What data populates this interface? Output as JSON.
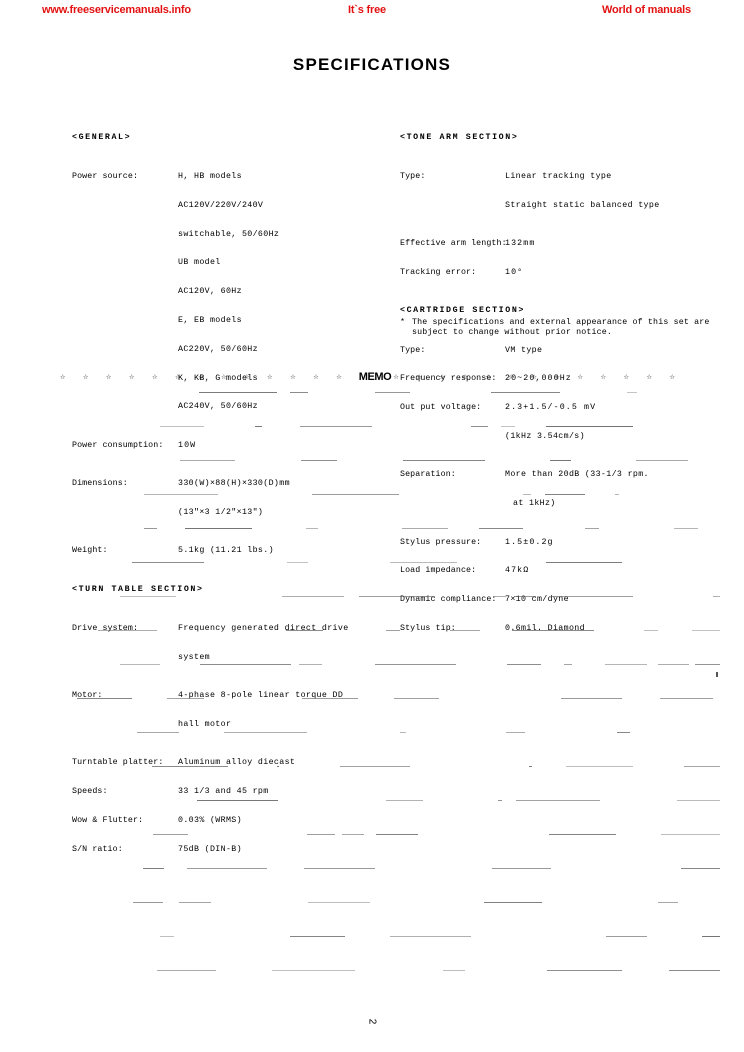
{
  "banner": {
    "left": "www.freeservicemanuals.info",
    "center": "It`s free",
    "right": "World of manuals",
    "color": "#e31111"
  },
  "title": "SPECIFICATIONS",
  "general": {
    "heading": "<GENERAL>",
    "rows": [
      {
        "label": "Power source:",
        "value": "H, HB models",
        "continued": [
          "  AC120V/220V/240V",
          "  switchable,  50/60Hz",
          "UB model",
          "  AC120V,  60Hz",
          "E, EB models",
          "  AC220V,  50/60Hz",
          "K, KB, G models",
          "  AC240V,  50/60Hz"
        ]
      },
      {
        "label": "Power consumption:",
        "value": "10W",
        "continued": []
      },
      {
        "label": "Dimensions:",
        "value": "330(W)×88(H)×330(D)mm",
        "continued": [
          "(13\"×3 1/2\"×13\")"
        ]
      },
      {
        "label": "Weight:",
        "value": "5.1kg (11.21 lbs.)",
        "continued": []
      }
    ]
  },
  "turntable": {
    "heading": "<TURN TABLE SECTION>",
    "rows": [
      {
        "label": "Drive system:",
        "value": "Frequency generated direct drive",
        "continued": [
          "system"
        ]
      },
      {
        "label": "Motor:",
        "value": "4-phase 8-pole linear torque DD",
        "continued": [
          "hall motor"
        ]
      },
      {
        "label": "Turntable platter:",
        "value": "Aluminum alloy diecast",
        "continued": []
      },
      {
        "label": "Speeds:",
        "value": "33 1/3 and 45 rpm",
        "continued": []
      },
      {
        "label": "Wow & Flutter:",
        "value": "0.03% (WRMS)",
        "continued": []
      },
      {
        "label": "S/N ratio:",
        "value": "75dB (DIN-B)",
        "continued": []
      }
    ]
  },
  "tonearm": {
    "heading": "<TONE ARM SECTION>",
    "rows": [
      {
        "label": "Type:",
        "value": "Linear tracking type",
        "continued": [
          "Straight static balanced type"
        ]
      },
      {
        "label": "Effective arm length:",
        "value": "132mm",
        "continued": []
      },
      {
        "label": "Tracking error:",
        "value": "10°",
        "continued": []
      }
    ]
  },
  "cartridge": {
    "heading": "<CARTRIDGE SECTION>",
    "rows": [
      {
        "label": "Type:",
        "value": "VM type",
        "continued": []
      },
      {
        "label": "Frequency response:",
        "value": "20~20,000Hz",
        "continued": []
      },
      {
        "label": "Out put voltage:",
        "value": "2.3+1.5/-0.5 mV",
        "continued": [
          "(1kHz 3.54cm/s)"
        ]
      },
      {
        "label": "Separation:",
        "value": "More than 20dB (33-1/3 rpm.",
        "continued": [
          "at 1kHz)"
        ]
      },
      {
        "label": "Stylus pressure:",
        "value": "1.5±0.2g",
        "continued": []
      },
      {
        "label": "Load impedance:",
        "value": "47kΩ",
        "continued": []
      },
      {
        "label": "Dynamic compliance:",
        "value": "7×10   cm/dyne",
        "continued": []
      },
      {
        "label": "Stylus tip:",
        "value": "0.6mil. Diamond",
        "continued": []
      }
    ]
  },
  "footnote": {
    "marker": "*",
    "text": "The specifications and external appearance of this set are\nsubject to change without prior notice."
  },
  "memo": {
    "label": "MEMO",
    "stars_left": "☆ ☆ ☆ ☆ ☆ ☆ ☆ ☆ ☆ ☆ ☆ ☆ ☆ ☆ ☆ ☆ ☆ ☆ ☆ ☆",
    "stars_right": "☆ ☆ ☆ ☆ ☆ ☆ ☆ ☆ ☆ ☆ ☆ ☆ ☆ ☆ ☆ ☆ ☆ ☆ ☆ ☆"
  },
  "page_number": "2"
}
